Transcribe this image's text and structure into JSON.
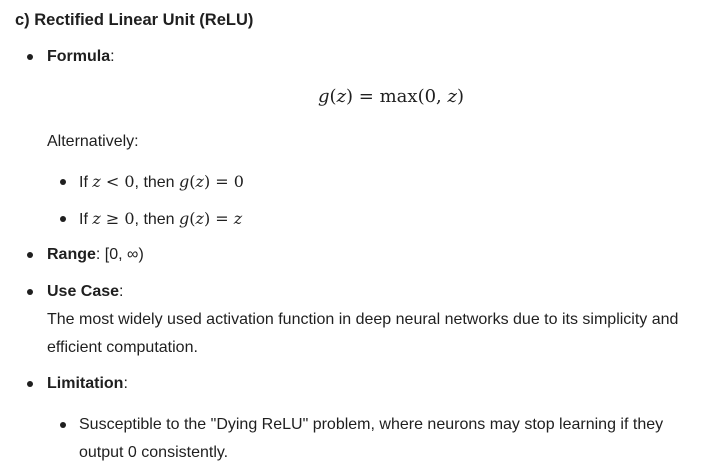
{
  "heading": "c) Rectified Linear Unit (ReLU)",
  "formula": {
    "label": "Formula",
    "colon": ":",
    "display": {
      "fn": "g",
      "arg": "z",
      "rhs_fn": "max",
      "rhs_args": "0, ",
      "rhs_var": "z"
    },
    "alternatively": "Alternatively:",
    "cases": [
      {
        "prefix": "If ",
        "cond_var": "z",
        "cond_op": " < ",
        "cond_val": "0",
        "mid": ", then ",
        "fn": "g",
        "arg": "z",
        "eq": " = ",
        "result": "0"
      },
      {
        "prefix": "If ",
        "cond_var": "z",
        "cond_op": " ≥ ",
        "cond_val": "0",
        "mid": ", then ",
        "fn": "g",
        "arg": "z",
        "eq": " = ",
        "result": "z"
      }
    ]
  },
  "range": {
    "label": "Range",
    "value": ": [0, ∞)"
  },
  "use_case": {
    "label": "Use Case",
    "colon": ":",
    "text": "The most widely used activation function in deep neural networks due to its simplicity and efficient computation."
  },
  "limitation": {
    "label": "Limitation",
    "colon": ":",
    "items": [
      "Susceptible to the \"Dying ReLU\" problem, where neurons may stop learning if they output 0 consistently."
    ]
  }
}
